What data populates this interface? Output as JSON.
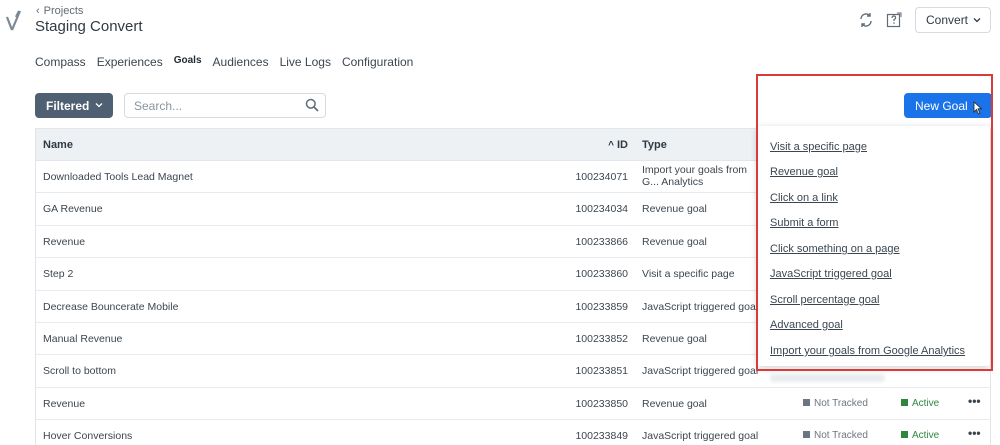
{
  "breadcrumb": {
    "label": "Projects"
  },
  "page_title": "Staging Convert",
  "project_select": {
    "value": "Convert"
  },
  "tabs": [
    {
      "label": "Compass",
      "active": false
    },
    {
      "label": "Experiences",
      "active": false
    },
    {
      "label": "Goals",
      "active": true
    },
    {
      "label": "Audiences",
      "active": false
    },
    {
      "label": "Live Logs",
      "active": false
    },
    {
      "label": "Configuration",
      "active": false
    }
  ],
  "toolbar": {
    "filter_label": "Filtered",
    "search_placeholder": "Search...",
    "new_goal_label": "New Goal"
  },
  "table": {
    "headers": {
      "name": "Name",
      "id": "ID",
      "type": "Type"
    },
    "rows": [
      {
        "name": "Downloaded Tools Lead Magnet",
        "id": "100234071",
        "type": "Import your goals from G... Analytics",
        "status": "",
        "state": ""
      },
      {
        "name": "GA Revenue",
        "id": "100234034",
        "type": "Revenue goal",
        "status": "",
        "state": ""
      },
      {
        "name": "Revenue",
        "id": "100233866",
        "type": "Revenue goal",
        "status": "",
        "state": ""
      },
      {
        "name": "Step 2",
        "id": "100233860",
        "type": "Visit a specific page",
        "status": "",
        "state": ""
      },
      {
        "name": "Decrease Bouncerate Mobile",
        "id": "100233859",
        "type": "JavaScript triggered goal",
        "status": "",
        "state": ""
      },
      {
        "name": "Manual Revenue",
        "id": "100233852",
        "type": "Revenue goal",
        "status": "",
        "state": ""
      },
      {
        "name": "Scroll to bottom",
        "id": "100233851",
        "type": "JavaScript triggered goal",
        "status": "",
        "state": ""
      },
      {
        "name": "Revenue",
        "id": "100233850",
        "type": "Revenue goal",
        "status": "Not Tracked",
        "state": "Active"
      },
      {
        "name": "Hover Conversions",
        "id": "100233849",
        "type": "JavaScript triggered goal",
        "status": "Not Tracked",
        "state": "Active"
      }
    ]
  },
  "dropdown": {
    "items": [
      "Visit a specific page",
      "Revenue goal",
      "Click on a link",
      "Submit a form",
      "Click something on a page",
      "JavaScript triggered goal",
      "Scroll percentage goal",
      "Advanced goal",
      "Import your goals from Google Analytics"
    ]
  },
  "icons": {
    "logo": "convert-logo-icon",
    "sync": "sync-icon",
    "help": "help-icon",
    "search": "search-icon",
    "sort": "sort-asc-icon",
    "more": "more-icon"
  },
  "colors": {
    "accent": "#1a73e8",
    "filter_bg": "#4e6072",
    "highlight": "#d93a3a",
    "active": "#2e8540"
  }
}
